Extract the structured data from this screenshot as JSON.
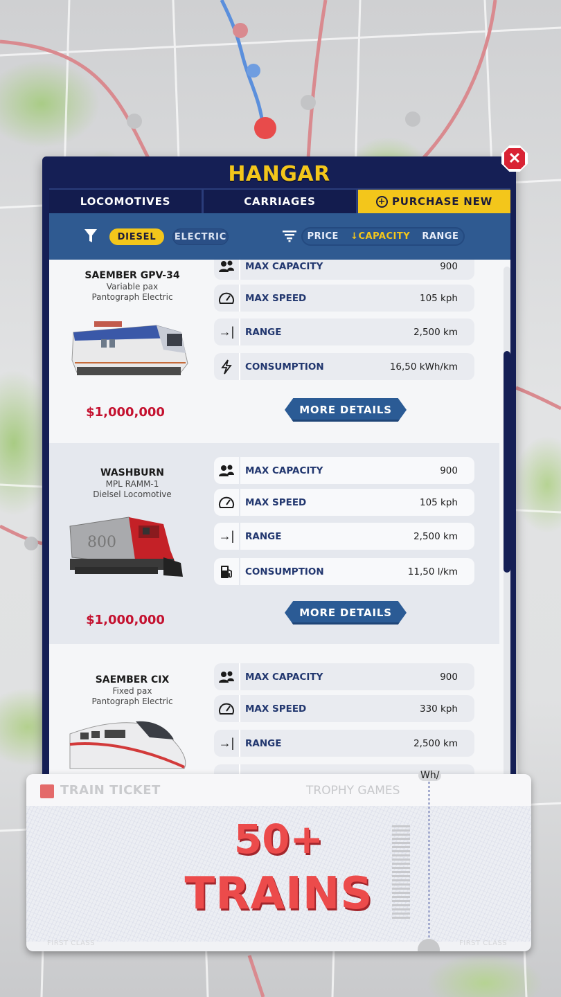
{
  "hangar": {
    "title": "HANGAR",
    "close_icon": "close-icon",
    "tabs": [
      {
        "label": "LOCOMOTIVES",
        "active": false
      },
      {
        "label": "CARRIAGES",
        "active": false
      },
      {
        "label": "PURCHASE NEW",
        "active": true,
        "icon": "plus-circle-icon"
      }
    ],
    "filters": {
      "icon": "filter-funnel-icon",
      "options": [
        {
          "label": "DIESEL",
          "selected": true
        },
        {
          "label": "ELECTRIC",
          "selected": false
        }
      ]
    },
    "sort": {
      "icon": "sort-lines-icon",
      "options": [
        {
          "label": "PRICE",
          "active": false
        },
        {
          "label": "↓CAPACITY",
          "active": true
        },
        {
          "label": "RANGE",
          "active": false
        }
      ]
    },
    "trains": [
      {
        "name": "SAEMBER GPV-34",
        "subtitle1": "Variable pax",
        "subtitle2": "Pantograph Electric",
        "price": "$1,000,000",
        "stats": [
          {
            "icon": "people-icon",
            "label": "MAX CAPACITY",
            "value": "900"
          },
          {
            "icon": "speedometer-icon",
            "label": "MAX SPEED",
            "value": "105 kph"
          },
          {
            "icon": "range-arrow-icon",
            "label": "RANGE",
            "value": "2,500 km"
          },
          {
            "icon": "lightning-icon",
            "label": "CONSUMPTION",
            "value": "16,50 kWh/km"
          }
        ],
        "button": "MORE DETAILS"
      },
      {
        "name": "WASHBURN",
        "subtitle1": "MPL RAMM-1",
        "subtitle2": "Dielsel Locomotive",
        "price": "$1,000,000",
        "stats": [
          {
            "icon": "people-icon",
            "label": "MAX CAPACITY",
            "value": "900"
          },
          {
            "icon": "speedometer-icon",
            "label": "MAX SPEED",
            "value": "105 kph"
          },
          {
            "icon": "range-arrow-icon",
            "label": "RANGE",
            "value": "2,500 km"
          },
          {
            "icon": "fuel-pump-icon",
            "label": "CONSUMPTION",
            "value": "11,50 l/km"
          }
        ],
        "button": "MORE DETAILS"
      },
      {
        "name": "SAEMBER CIX",
        "subtitle1": "Fixed pax",
        "subtitle2": "Pantograph Electric",
        "stats": [
          {
            "icon": "people-icon",
            "label": "MAX CAPACITY",
            "value": "900"
          },
          {
            "icon": "speedometer-icon",
            "label": "MAX SPEED",
            "value": "330 kph"
          },
          {
            "icon": "range-arrow-icon",
            "label": "RANGE",
            "value": "2,500 km"
          }
        ],
        "partial_value": "Wh/"
      }
    ],
    "scroll_position": 0.25
  },
  "ticket": {
    "title": "TRAIN TICKET",
    "brand": "TROPHY GAMES",
    "headline1": "50+",
    "headline2": "TRAINS",
    "footer_left": "FIRST CLASS",
    "footer_right": "FIRST CLASS"
  }
}
